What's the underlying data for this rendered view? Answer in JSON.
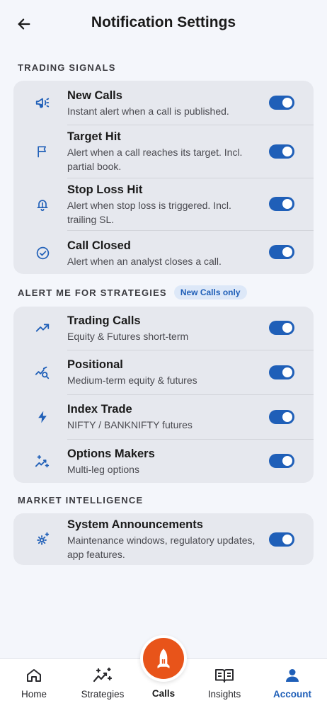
{
  "header": {
    "title": "Notification Settings"
  },
  "sections": {
    "trading_signals": {
      "label": "TRADING SIGNALS",
      "items": [
        {
          "title": "New Calls",
          "desc": "Instant alert when a call is published.",
          "icon": "megaphone-icon",
          "enabled": true
        },
        {
          "title": "Target Hit",
          "desc": "Alert when a call reaches its target. Incl. partial book.",
          "icon": "flag-icon",
          "enabled": true
        },
        {
          "title": "Stop Loss Hit",
          "desc": "Alert when stop loss is triggered. Incl. trailing SL.",
          "icon": "bell-alert-icon",
          "enabled": true
        },
        {
          "title": "Call Closed",
          "desc": "Alert when an analyst closes a call.",
          "icon": "check-circle-icon",
          "enabled": true
        }
      ]
    },
    "strategies": {
      "label": "ALERT ME FOR STRATEGIES",
      "badge": "New Calls only",
      "items": [
        {
          "title": "Trading Calls",
          "desc": "Equity & Futures short-term",
          "icon": "trending-up-icon",
          "enabled": true
        },
        {
          "title": "Positional",
          "desc": "Medium-term equity & futures",
          "icon": "chart-search-icon",
          "enabled": true
        },
        {
          "title": "Index Trade",
          "desc": "NIFTY / BANKNIFTY futures",
          "icon": "lightning-icon",
          "enabled": true
        },
        {
          "title": "Options Makers",
          "desc": "Multi-leg options",
          "icon": "sparkle-trend-icon",
          "enabled": true
        }
      ]
    },
    "market_intelligence": {
      "label": "MARKET INTELLIGENCE",
      "items": [
        {
          "title": "System Announcements",
          "desc": "Maintenance windows, regulatory updates, app features.",
          "icon": "gear-sparkle-icon",
          "enabled": true
        }
      ]
    }
  },
  "nav": {
    "items": [
      {
        "label": "Home",
        "icon": "home-icon"
      },
      {
        "label": "Strategies",
        "icon": "strategies-icon"
      },
      {
        "label": "Calls",
        "icon": "rocket-icon"
      },
      {
        "label": "Insights",
        "icon": "book-icon"
      },
      {
        "label": "Account",
        "icon": "user-icon",
        "active": true
      }
    ]
  },
  "colors": {
    "accent": "#1f5fb8",
    "fab": "#e8541a",
    "card": "#e6e8ee",
    "background": "#f4f6fb"
  }
}
